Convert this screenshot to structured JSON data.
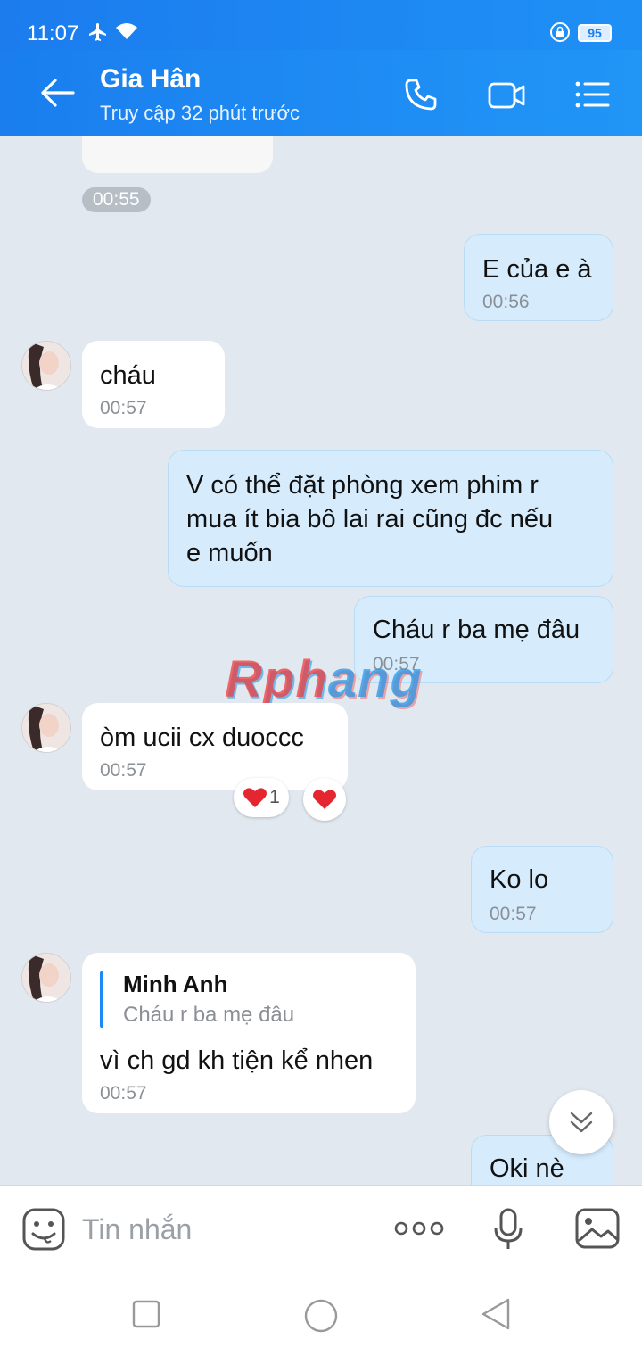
{
  "status_bar": {
    "time": "11:07",
    "battery": "95"
  },
  "header": {
    "contact_name": "Gia Hân",
    "contact_status": "Truy cập 32 phút trước"
  },
  "chat": {
    "top_time_pill": "00:55",
    "messages": [
      {
        "side": "out",
        "text": "E của e à",
        "time": "00:56"
      },
      {
        "side": "in",
        "text": "cháu",
        "time": "00:57"
      },
      {
        "side": "out",
        "text": "V có thể đặt phòng xem phim r\nmua ít bia bô lai rai cũng đc nếu\ne muốn",
        "time": ""
      },
      {
        "side": "out",
        "text": "Cháu r ba mẹ đâu",
        "time": "00:57"
      },
      {
        "side": "in",
        "text": "òm ucii cx duoccc",
        "time": "00:57",
        "reaction_count": "1"
      },
      {
        "side": "out",
        "text": "Ko lo",
        "time": "00:57"
      },
      {
        "side": "in",
        "quote_name": "Minh Anh",
        "quote_text": "Cháu r ba mẹ đâu",
        "text": "vì ch gd kh tiện kể nhen",
        "time": "00:57"
      },
      {
        "side": "out",
        "text": "Oki nè",
        "time": ""
      }
    ],
    "watermark_part1": "Rph",
    "watermark_part2": "ang"
  },
  "input_bar": {
    "placeholder": "Tin nhắn"
  },
  "colors": {
    "header_blue": "#1e88f3",
    "outgoing_bubble": "#d6ecfd",
    "incoming_bubble": "#ffffff",
    "chat_background": "#e2e8ef"
  }
}
